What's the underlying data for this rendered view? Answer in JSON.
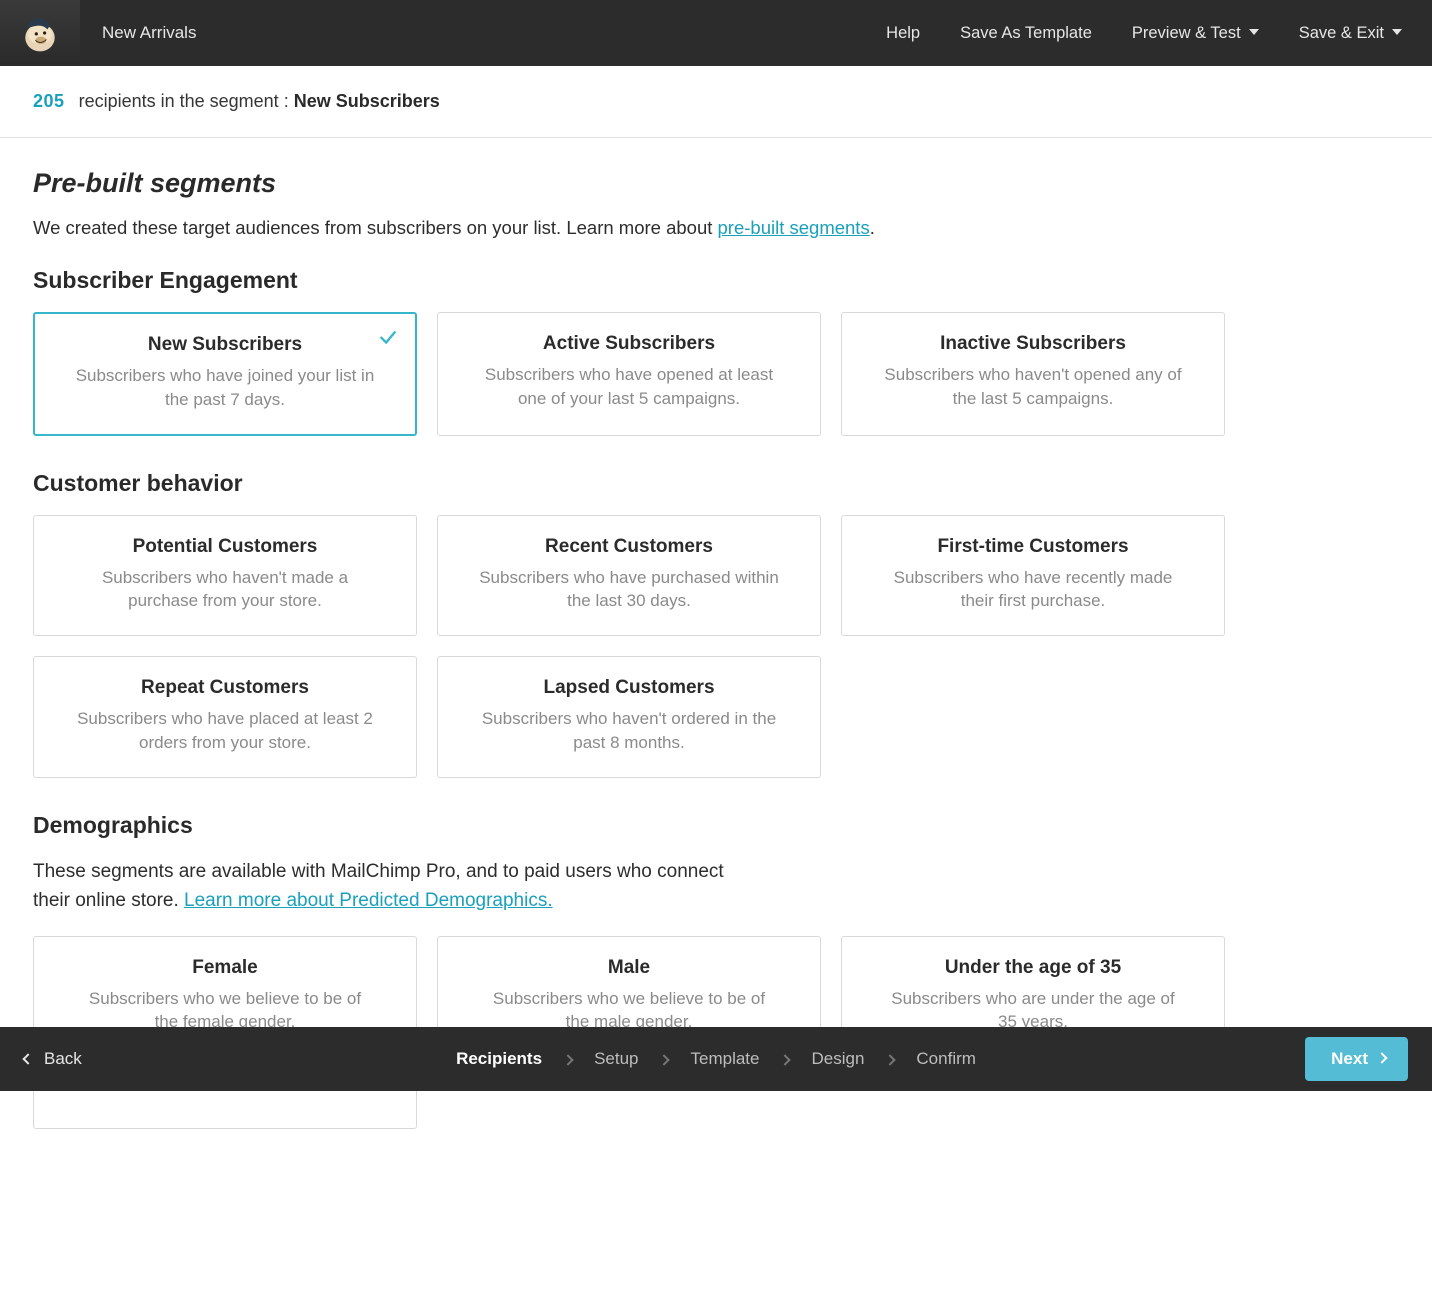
{
  "header": {
    "title": "New Arrivals",
    "links": {
      "help": "Help",
      "save_as_template": "Save As Template",
      "preview_test": "Preview & Test",
      "save_exit": "Save & Exit"
    }
  },
  "subbar": {
    "count": "205",
    "middle_text": "recipients in the segment :",
    "segment_name": "New Subscribers"
  },
  "intro": {
    "heading": "Pre-built segments",
    "text_before": "We created these target audiences from subscribers on your list. Learn more about ",
    "link_text": "pre-built segments",
    "text_after": "."
  },
  "sections": [
    {
      "id": "engagement",
      "title": "Subscriber Engagement",
      "cards": [
        {
          "title": "New Subscribers",
          "desc": "Subscribers who have joined your list in the past 7 days.",
          "selected": true
        },
        {
          "title": "Active Subscribers",
          "desc": "Subscribers who have opened at least one of your last 5 campaigns."
        },
        {
          "title": "Inactive Subscribers",
          "desc": "Subscribers who haven't opened any of the last 5 campaigns."
        }
      ]
    },
    {
      "id": "customer",
      "title": "Customer behavior",
      "cards": [
        {
          "title": "Potential Customers",
          "desc": "Subscribers who haven't made a purchase from your store."
        },
        {
          "title": "Recent Customers",
          "desc": "Subscribers who have purchased within the last 30 days."
        },
        {
          "title": "First-time Customers",
          "desc": "Subscribers who have recently made their first purchase."
        },
        {
          "title": "Repeat Customers",
          "desc": "Subscribers who have placed at least 2 orders from your store."
        },
        {
          "title": "Lapsed Customers",
          "desc": "Subscribers who haven't ordered in the past 8 months."
        }
      ]
    },
    {
      "id": "demographics",
      "title": "Demographics",
      "desc_before": "These segments are available with MailChimp Pro, and to paid users who connect their online store. ",
      "desc_link": "Learn more about Predicted Demographics.",
      "cards": [
        {
          "title": "Female",
          "desc": "Subscribers who we believe to be of the female gender."
        },
        {
          "title": "Male",
          "desc": "Subscribers who we believe to be of the male gender."
        },
        {
          "title": "Under the age of 35",
          "desc": "Subscribers who are under the age of 35 years."
        },
        {
          "title": "",
          "desc": ""
        }
      ]
    }
  ],
  "footer": {
    "back": "Back",
    "next": "Next",
    "steps": [
      "Recipients",
      "Setup",
      "Template",
      "Design",
      "Confirm"
    ],
    "active_step": 0
  }
}
